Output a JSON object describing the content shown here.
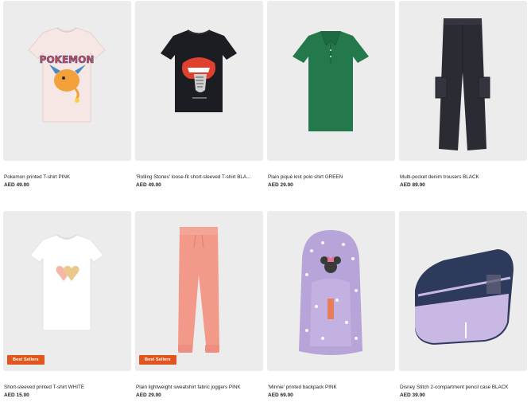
{
  "products": [
    {
      "title": "Pokemon printed T-shirt PINK",
      "price": "AED 49.00",
      "badge": ""
    },
    {
      "title": "'Rolling Stones' loose-fit short-sleeved T-shirt BLA...",
      "price": "AED 49.00",
      "badge": ""
    },
    {
      "title": "Plain piqué knit polo shirt GREEN",
      "price": "AED 29.00",
      "badge": ""
    },
    {
      "title": "Multi-pocket denim trousers BLACK",
      "price": "AED 89.00",
      "badge": ""
    },
    {
      "title": "Short-sleeved printed T-shirt WHITE",
      "price": "AED 15.00",
      "badge": "Best Sellers"
    },
    {
      "title": "Plain lightweight sweatshirt fabric joggers PINK",
      "price": "AED 29.00",
      "badge": "Best Sellers"
    },
    {
      "title": "'Minnie' printed backpack PINK",
      "price": "AED 69.00",
      "badge": ""
    },
    {
      "title": "Disney Stitch 2-compartment pencil case BLACK",
      "price": "AED 39.00",
      "badge": ""
    }
  ],
  "artwork_text": {
    "pokemon_logo": "POKEMON"
  },
  "colors": {
    "badge": "#e2561e",
    "image_bg": "#eeeeee"
  }
}
